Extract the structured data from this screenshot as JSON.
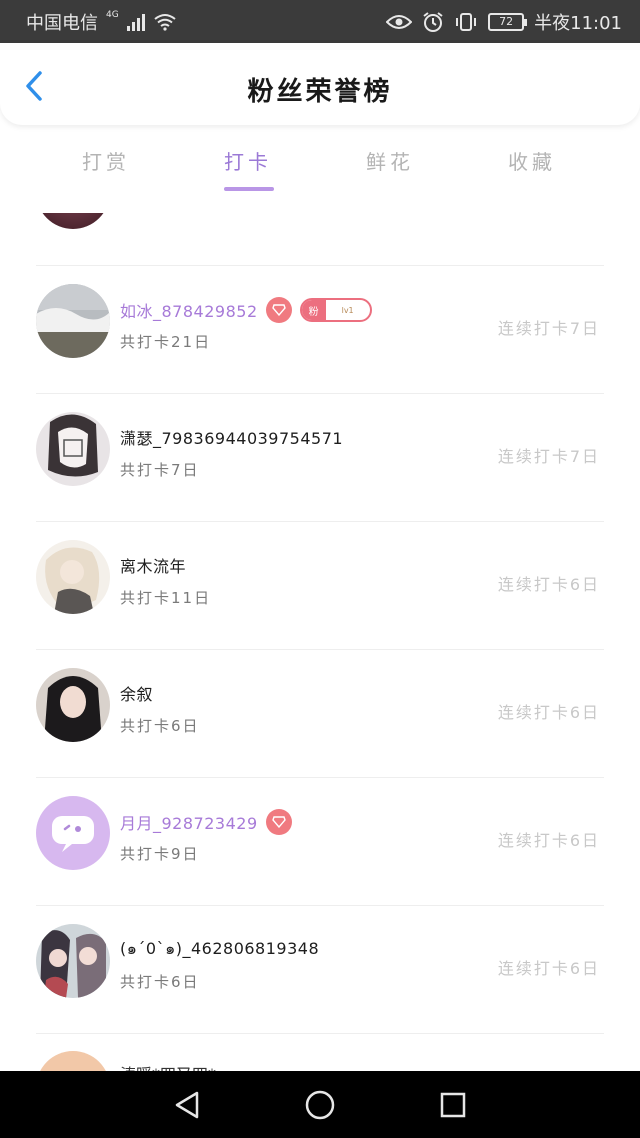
{
  "status": {
    "carrier": "中国电信",
    "network": "4G",
    "battery": "72",
    "time": "半夜11:01"
  },
  "header": {
    "title": "粉丝荣誉榜"
  },
  "tabs": [
    {
      "label": "打赏",
      "active": false
    },
    {
      "label": "打卡",
      "active": true
    },
    {
      "label": "鲜花",
      "active": false
    },
    {
      "label": "收藏",
      "active": false
    }
  ],
  "rows": [
    {
      "name": "如冰_878429852",
      "sub": "共打卡21日",
      "streak": "连续打卡7日",
      "name_color": "purple",
      "gem": true,
      "fan_badge": {
        "left": "粉",
        "right": "lv1"
      }
    },
    {
      "name": "潇瑟_79836944039754571",
      "sub": "共打卡7日",
      "streak": "连续打卡7日"
    },
    {
      "name": "离木流年",
      "sub": "共打卡11日",
      "streak": "连续打卡6日"
    },
    {
      "name": "余叙",
      "sub": "共打卡6日",
      "streak": "连续打卡6日"
    },
    {
      "name": "月月_928723429",
      "sub": "共打卡9日",
      "streak": "连续打卡6日",
      "name_color": "purple",
      "gem": true
    },
    {
      "name": "(๑´0`๑)_462806819348",
      "sub": "共打卡6日",
      "streak": "连续打卡6日"
    }
  ],
  "bottom_partial_name": "涛暖*四又四*"
}
